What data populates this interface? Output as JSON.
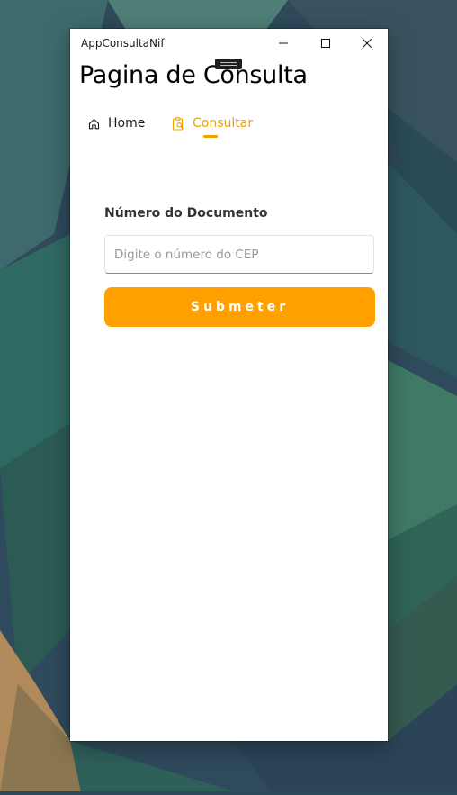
{
  "window": {
    "title": "AppConsultaNif",
    "minimize_icon": "minimize-icon",
    "maximize_icon": "maximize-icon",
    "close_icon": "close-icon"
  },
  "page": {
    "title": "Pagina de Consulta"
  },
  "nav": {
    "items": [
      {
        "label": "Home",
        "icon": "home-icon",
        "selected": false
      },
      {
        "label": "Consultar",
        "icon": "clipboard-search-icon",
        "selected": true
      }
    ]
  },
  "form": {
    "label": "Número do Documento",
    "input_value": "",
    "input_placeholder": "Digite o número do CEP",
    "submit_label": "Submeter"
  },
  "colors": {
    "accent": "#ffa000",
    "nav_selected": "#f0a000",
    "window_bg": "#ffffff"
  }
}
